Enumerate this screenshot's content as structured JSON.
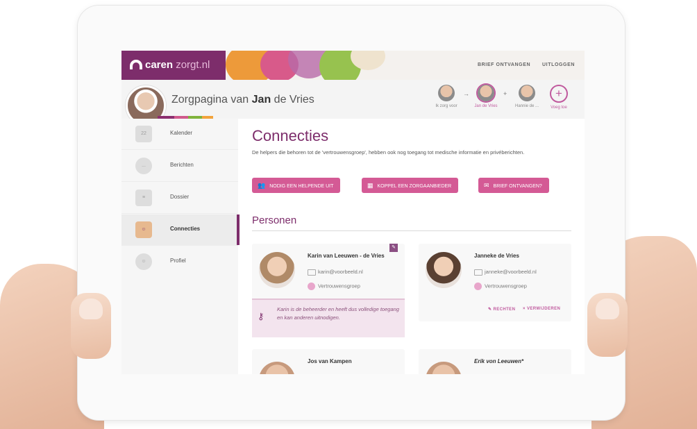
{
  "brand": {
    "logo_main": "caren",
    "logo_suffix": " zorgt.nl"
  },
  "topnav": {
    "brief": "BRIEF ONTVANGEN",
    "logout": "UITLOGGEN"
  },
  "header": {
    "title_prefix": "Zorgpagina van ",
    "title_name": "Jan",
    "title_suffix": " de Vries"
  },
  "switcher": {
    "items": [
      {
        "label": "Ik zorg voor",
        "active": false
      },
      {
        "label": "Jan de Vries",
        "active": true
      },
      {
        "label": "Hannie de ...",
        "active": false
      }
    ],
    "add_label": "Voeg toe",
    "add_icon": "+"
  },
  "sidebar": {
    "items": [
      {
        "label": "Kalender",
        "icon": "calendar-icon",
        "glyph": "22"
      },
      {
        "label": "Berichten",
        "icon": "chat-icon",
        "glyph": "..."
      },
      {
        "label": "Dossier",
        "icon": "clipboard-icon",
        "glyph": "≡"
      },
      {
        "label": "Connecties",
        "icon": "people-icon",
        "glyph": "☺",
        "active": true
      },
      {
        "label": "Profiel",
        "icon": "person-icon",
        "glyph": "☺"
      }
    ]
  },
  "main": {
    "title": "Connecties",
    "intro": "De helpers die behoren tot de 'vertrouwensgroep', hebben ook nog toegang tot medische informatie en privéberichten.",
    "actions": [
      {
        "label": "NODIG EEN HELPENDE UIT",
        "icon": "add-people-icon"
      },
      {
        "label": "KOPPEL EEN ZORGAANBIEDER",
        "icon": "link-provider-icon"
      },
      {
        "label": "BRIEF ONTVANGEN?",
        "icon": "mail-icon"
      }
    ],
    "section": "Personen"
  },
  "people": [
    {
      "name": "Karin van Leeuwen - de Vries",
      "email": "karin@voorbeeld.nl",
      "group": "Vertrouwensgroep",
      "note": "Karin is de beheerder en heeft dus volledige toegang en kan anderen uitnodigen."
    },
    {
      "name": "Janneke de Vries",
      "email": "janneke@voorbeeld.nl",
      "group": "Vertrouwensgroep",
      "actions": {
        "rights": "RECHTEN",
        "remove": "VERWIJDEREN"
      }
    },
    {
      "name": "Jos van Kampen"
    },
    {
      "name": "Erik von Leeuwen*"
    }
  ],
  "colors": {
    "brand": "#7d2d6b",
    "accent": "#d45a95",
    "note_bg": "#f3e4ee"
  }
}
